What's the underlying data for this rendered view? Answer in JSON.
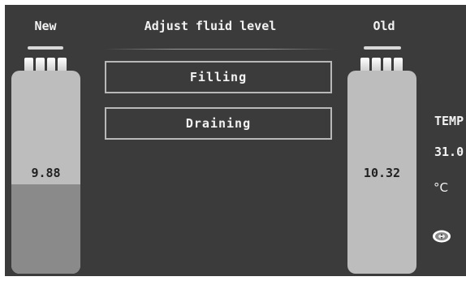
{
  "header": {
    "left_title": "New",
    "center_title": "Adjust fluid level",
    "right_title": "Old"
  },
  "new_tank": {
    "value": "9.88",
    "fill_fraction": 0.44
  },
  "old_tank": {
    "value": "10.32",
    "fill_fraction": 0.0
  },
  "buttons": {
    "filling": "Filling",
    "draining": "Draining"
  },
  "temperature": {
    "label": "TEMP",
    "value": "31.0",
    "unit": "°C"
  },
  "icons": {
    "settings": "settings-icon"
  },
  "colors": {
    "background": "#3b3b3b",
    "bottle": "#bdbdbd",
    "bottle_fill": "#8a8a8a",
    "text": "#f2f2f2"
  }
}
